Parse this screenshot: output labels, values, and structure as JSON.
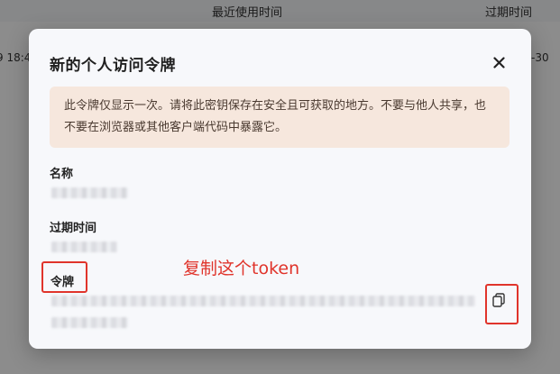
{
  "background": {
    "columns": {
      "last_used": "最近使用时间",
      "expires": "过期时间"
    },
    "row": {
      "left_fragment": "9 18:4",
      "right_fragment": "-30"
    }
  },
  "modal": {
    "title": "新的个人访问令牌",
    "notice": "此令牌仅显示一次。请将此密钥保存在安全且可获取的地方。不要与他人共享，也不要在浏览器或其他客户端代码中暴露它。",
    "fields": {
      "name_label": "名称",
      "expire_label": "过期时间",
      "token_label": "令牌"
    }
  },
  "annotation": {
    "text": "复制这个token",
    "color": "#e0342b"
  },
  "colors": {
    "notice_bg": "#f6e7dd",
    "modal_bg": "#f7f8fb"
  },
  "icons": {
    "close": "close-icon",
    "copy": "copy-icon"
  }
}
